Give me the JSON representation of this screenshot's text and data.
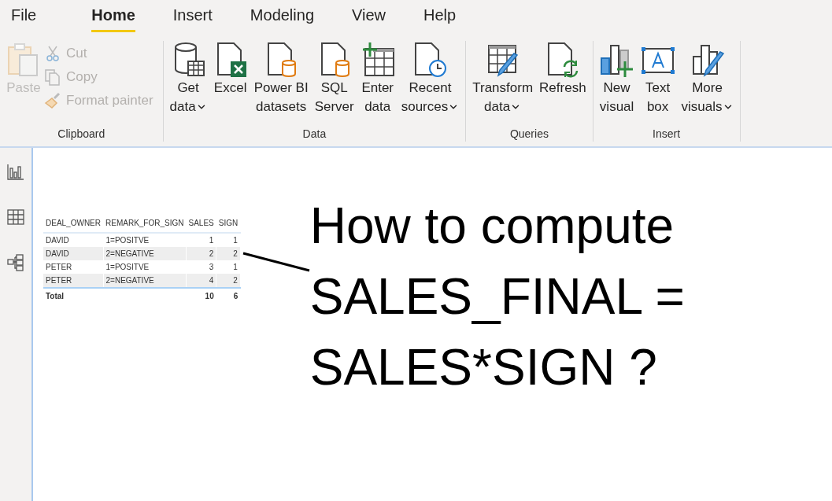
{
  "tabs": [
    {
      "label": "File",
      "selected": false
    },
    {
      "label": "Home",
      "selected": true
    },
    {
      "label": "Insert",
      "selected": false
    },
    {
      "label": "Modeling",
      "selected": false
    },
    {
      "label": "View",
      "selected": false
    },
    {
      "label": "Help",
      "selected": false
    }
  ],
  "groups": [
    {
      "title": "Clipboard",
      "items": [
        {
          "kind": "large",
          "lines": [
            "Paste"
          ],
          "dropdown": false,
          "disabled": true
        },
        {
          "kind": "small",
          "lines": [
            "Cut"
          ],
          "disabled": true
        },
        {
          "kind": "small",
          "lines": [
            "Copy"
          ],
          "disabled": true
        },
        {
          "kind": "small",
          "lines": [
            "Format painter"
          ],
          "disabled": true
        }
      ]
    },
    {
      "title": "Data",
      "items": [
        {
          "kind": "large",
          "lines": [
            "Get",
            "data"
          ],
          "dropdown": true,
          "disabled": false
        },
        {
          "kind": "large",
          "lines": [
            "Excel"
          ],
          "dropdown": false,
          "disabled": false
        },
        {
          "kind": "large",
          "lines": [
            "Power BI",
            "datasets"
          ],
          "dropdown": false,
          "disabled": false
        },
        {
          "kind": "large",
          "lines": [
            "SQL",
            "Server"
          ],
          "dropdown": false,
          "disabled": false
        },
        {
          "kind": "large",
          "lines": [
            "Enter",
            "data"
          ],
          "dropdown": false,
          "disabled": false
        },
        {
          "kind": "large",
          "lines": [
            "Recent",
            "sources"
          ],
          "dropdown": true,
          "disabled": false
        }
      ]
    },
    {
      "title": "Queries",
      "items": [
        {
          "kind": "large",
          "lines": [
            "Transform",
            "data"
          ],
          "dropdown": true,
          "disabled": false
        },
        {
          "kind": "large",
          "lines": [
            "Refresh"
          ],
          "dropdown": false,
          "disabled": false
        }
      ]
    },
    {
      "title": "Insert",
      "items": [
        {
          "kind": "large",
          "lines": [
            "New",
            "visual"
          ],
          "dropdown": false,
          "disabled": false
        },
        {
          "kind": "large",
          "lines": [
            "Text",
            "box"
          ],
          "dropdown": false,
          "disabled": false
        },
        {
          "kind": "large",
          "lines": [
            "More",
            "visuals"
          ],
          "dropdown": true,
          "disabled": false
        }
      ]
    }
  ],
  "table": {
    "columns": [
      "DEAL_OWNER",
      "REMARK_FOR_SIGN",
      "SALES",
      "SIGN"
    ],
    "rows": [
      [
        "DAVID",
        "1=POSITVE",
        "1",
        "1"
      ],
      [
        "DAVID",
        "2=NEGATIVE",
        "2",
        "2"
      ],
      [
        "PETER",
        "1=POSITVE",
        "3",
        "1"
      ],
      [
        "PETER",
        "2=NEGATIVE",
        "4",
        "2"
      ]
    ],
    "total": {
      "label": "Total",
      "values": [
        "10",
        "6"
      ]
    }
  },
  "annotation": {
    "lines": [
      "How to compute",
      "SALES_FINAL =",
      "SALES*SIGN ?"
    ]
  }
}
